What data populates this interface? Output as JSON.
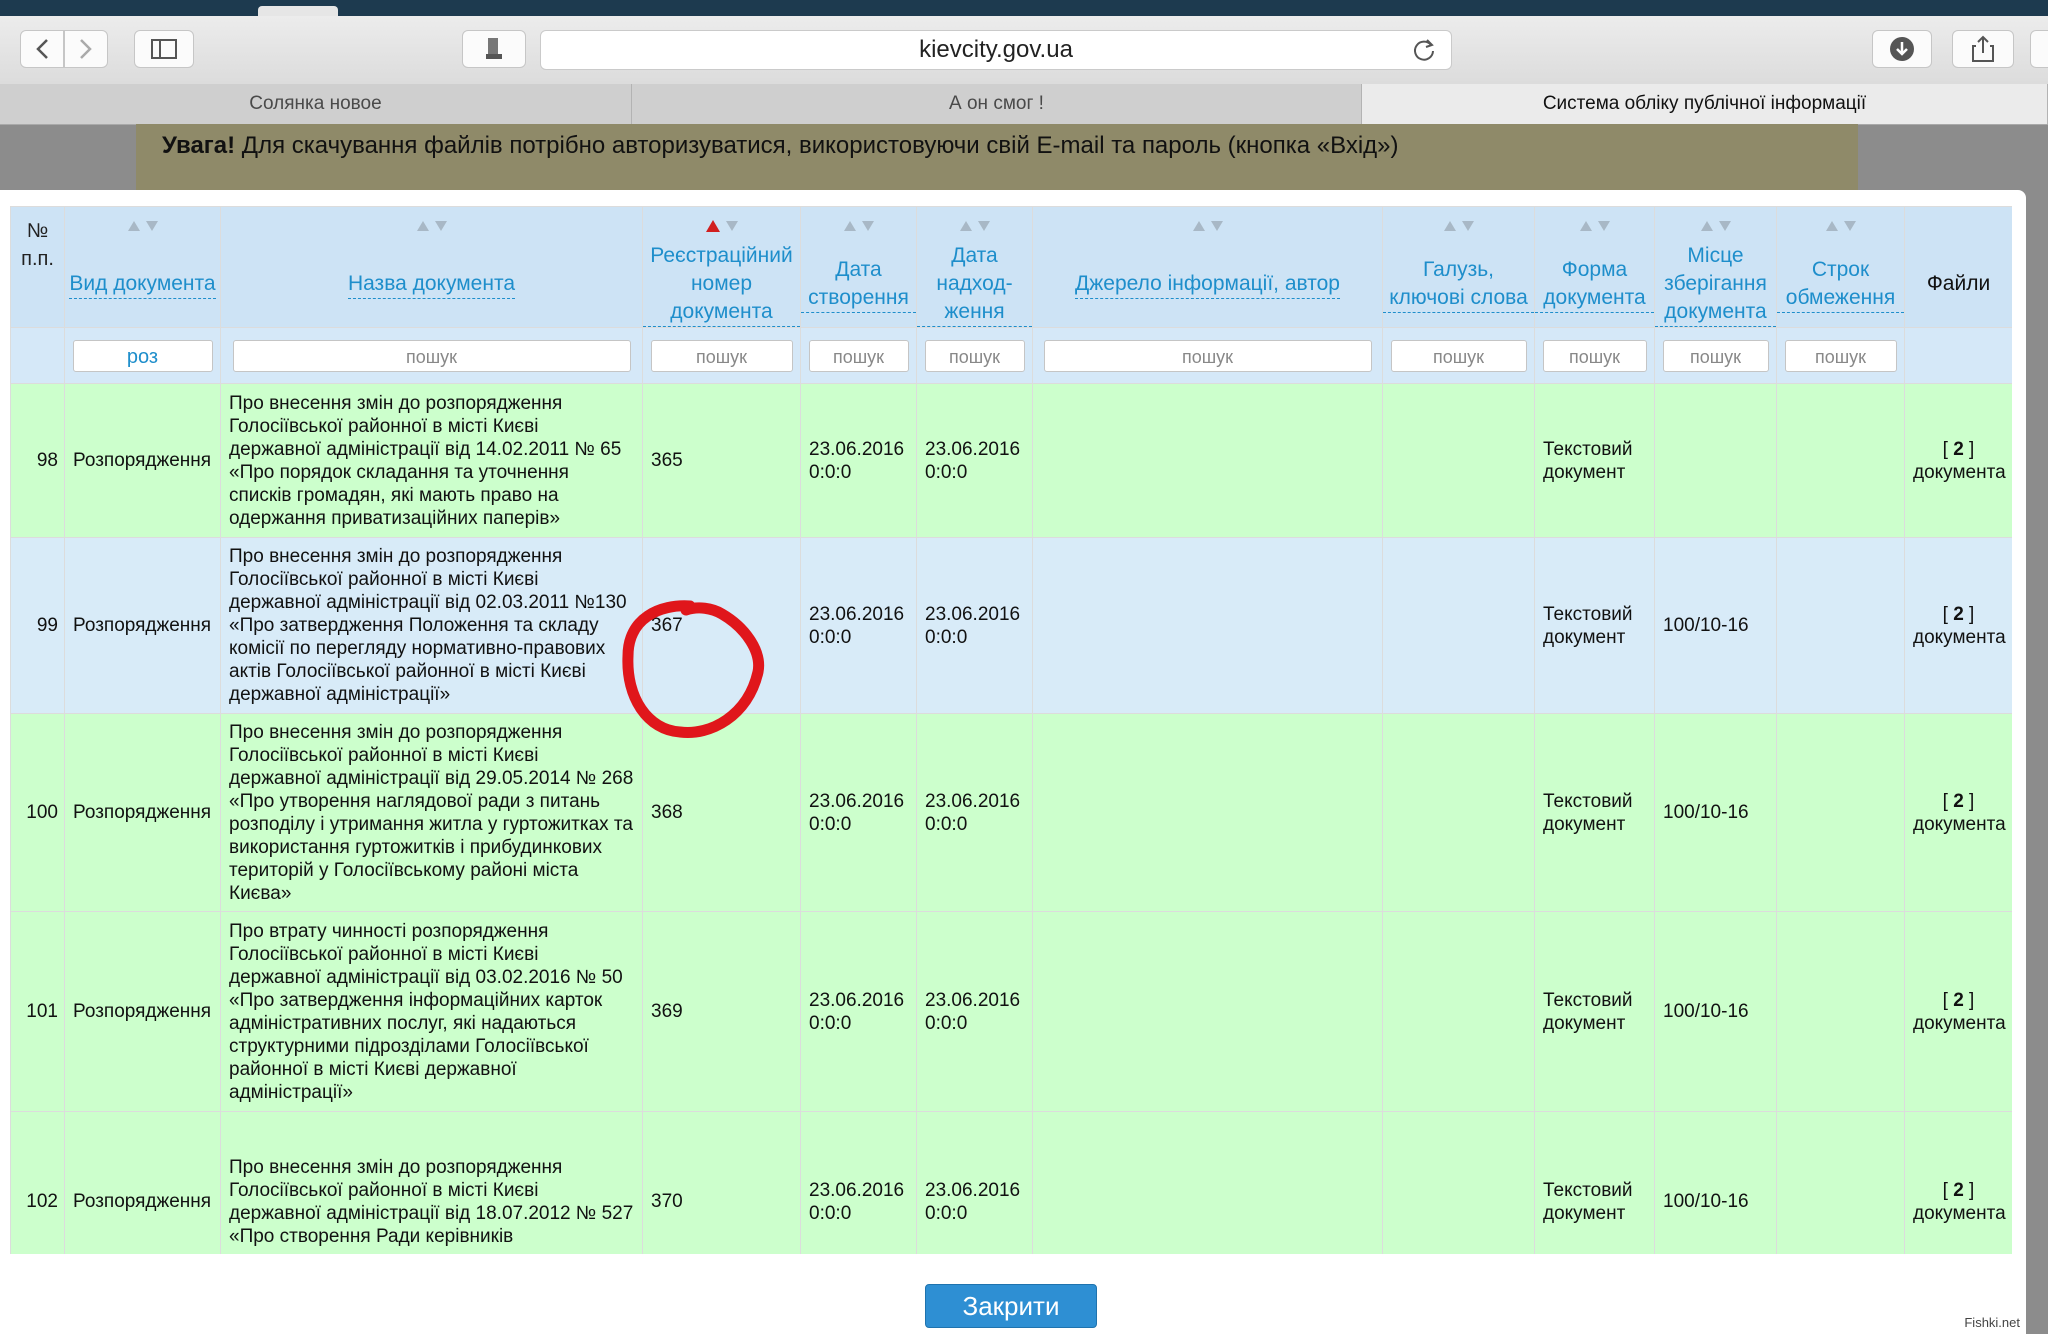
{
  "browser": {
    "url": "kievcity.gov.ua",
    "tabs": [
      {
        "label": "Солянка новое"
      },
      {
        "label": "А он смог !"
      },
      {
        "label": "Система обліку публічної інформації"
      }
    ],
    "icons": [
      "back-icon",
      "forward-icon",
      "sidebar-icon",
      "extension-icon",
      "reload-icon",
      "download-icon",
      "share-icon"
    ]
  },
  "notice": {
    "bold": "Увага!",
    "text": " Для скачування файлів потрібно авторизуватися, використовуючи свій E-mail та пароль (кнопка «Вхід»)"
  },
  "table": {
    "num_header": "№ п.п.",
    "columns": [
      {
        "label": "Вид документа",
        "filter": "роз"
      },
      {
        "label": "Назва документа",
        "filter": "пошук"
      },
      {
        "label": "Реєстраційний номер документа",
        "filter": "пошук"
      },
      {
        "label": "Дата створення",
        "filter": "пошук"
      },
      {
        "label": "Дата надход-ження",
        "filter": "пошук"
      },
      {
        "label": "Джерело інформації, автор",
        "filter": "пошук"
      },
      {
        "label": "Галузь, ключові слова",
        "filter": "пошук"
      },
      {
        "label": "Форма документа",
        "filter": "пошук"
      },
      {
        "label": "Місце зберігання документа",
        "filter": "пошук"
      },
      {
        "label": "Строк обмеження",
        "filter": "пошук"
      },
      {
        "label": "Файли"
      }
    ],
    "sort_active_color": "#d11f1f",
    "rows": [
      {
        "num": "98",
        "type": "Розпорядження",
        "title": "Про внесення змін до розпорядження Голосіївської районної в місті Києві державної адміністрації від 14.02.2011 № 65 «Про порядок складання та уточнення списків громадян, які мають право на одержання приватизаційних паперів»",
        "reg": "365",
        "created": "23.06.2016 0:0:0",
        "received": "23.06.2016 0:0:0",
        "source": "",
        "keywords": "",
        "form": "Текстовий документ",
        "storage": "",
        "limit": "",
        "files_count": "2",
        "files_word": "документа"
      },
      {
        "num": "99",
        "type": "Розпорядження",
        "title": "Про внесення змін до розпорядження Голосіївської районної в місті Києві державної адміністрації від 02.03.2011 №130 «Про затвердження Положення та складу комісії по перегляду нормативно-правових актів Голосіївської районної в місті Києві державної адміністрації»",
        "reg": "367",
        "created": "23.06.2016 0:0:0",
        "received": "23.06.2016 0:0:0",
        "source": "",
        "keywords": "",
        "form": "Текстовий документ",
        "storage": "100/10-16",
        "limit": "",
        "files_count": "2",
        "files_word": "документа"
      },
      {
        "num": "100",
        "type": "Розпорядження",
        "title": "Про внесення змін до розпорядження Голосіївської районної в місті Києві державної адміністрації від 29.05.2014 № 268 «Про утворення наглядової ради з питань розподілу і утримання житла у гуртожитках та використання гуртожитків і прибудинкових територій у Голосіївському районі міста Києва»",
        "reg": "368",
        "created": "23.06.2016 0:0:0",
        "received": "23.06.2016 0:0:0",
        "source": "",
        "keywords": "",
        "form": "Текстовий документ",
        "storage": "100/10-16",
        "limit": "",
        "files_count": "2",
        "files_word": "документа"
      },
      {
        "num": "101",
        "type": "Розпорядження",
        "title": "Про втрату чинності розпорядження Голосіївської районної в місті Києві державної адміністрації від 03.02.2016 № 50 «Про затвердження інформаційних карток адміністративних послуг, які надаються структурними підрозділами Голосіївської районної в місті Києві державної адміністрації»",
        "reg": "369",
        "created": "23.06.2016 0:0:0",
        "received": "23.06.2016 0:0:0",
        "source": "",
        "keywords": "",
        "form": "Текстовий документ",
        "storage": "100/10-16",
        "limit": "",
        "files_count": "2",
        "files_word": "документа"
      },
      {
        "num": "102",
        "type": "Розпорядження",
        "title": "Про внесення змін до розпорядження Голосіївської районної в місті Києві державної адміністрації від 18.07.2012 № 527 «Про створення Ради керівників",
        "reg": "370",
        "created": "23.06.2016 0:0:0",
        "received": "23.06.2016 0:0:0",
        "source": "",
        "keywords": "",
        "form": "Текстовий документ",
        "storage": "100/10-16",
        "limit": "",
        "files_count": "2",
        "files_word": "документа"
      }
    ]
  },
  "close_label": "Закрити",
  "watermark": "Fishki.net",
  "annotation_color": "#e0161b"
}
